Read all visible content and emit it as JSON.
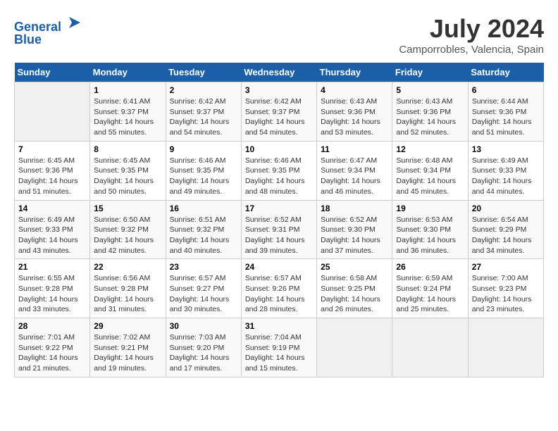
{
  "header": {
    "logo_line1": "General",
    "logo_line2": "Blue",
    "month_year": "July 2024",
    "location": "Camporrobles, Valencia, Spain"
  },
  "weekdays": [
    "Sunday",
    "Monday",
    "Tuesday",
    "Wednesday",
    "Thursday",
    "Friday",
    "Saturday"
  ],
  "weeks": [
    [
      {
        "day": "",
        "text": ""
      },
      {
        "day": "1",
        "text": "Sunrise: 6:41 AM\nSunset: 9:37 PM\nDaylight: 14 hours\nand 55 minutes."
      },
      {
        "day": "2",
        "text": "Sunrise: 6:42 AM\nSunset: 9:37 PM\nDaylight: 14 hours\nand 54 minutes."
      },
      {
        "day": "3",
        "text": "Sunrise: 6:42 AM\nSunset: 9:37 PM\nDaylight: 14 hours\nand 54 minutes."
      },
      {
        "day": "4",
        "text": "Sunrise: 6:43 AM\nSunset: 9:36 PM\nDaylight: 14 hours\nand 53 minutes."
      },
      {
        "day": "5",
        "text": "Sunrise: 6:43 AM\nSunset: 9:36 PM\nDaylight: 14 hours\nand 52 minutes."
      },
      {
        "day": "6",
        "text": "Sunrise: 6:44 AM\nSunset: 9:36 PM\nDaylight: 14 hours\nand 51 minutes."
      }
    ],
    [
      {
        "day": "7",
        "text": "Sunrise: 6:45 AM\nSunset: 9:36 PM\nDaylight: 14 hours\nand 51 minutes."
      },
      {
        "day": "8",
        "text": "Sunrise: 6:45 AM\nSunset: 9:35 PM\nDaylight: 14 hours\nand 50 minutes."
      },
      {
        "day": "9",
        "text": "Sunrise: 6:46 AM\nSunset: 9:35 PM\nDaylight: 14 hours\nand 49 minutes."
      },
      {
        "day": "10",
        "text": "Sunrise: 6:46 AM\nSunset: 9:35 PM\nDaylight: 14 hours\nand 48 minutes."
      },
      {
        "day": "11",
        "text": "Sunrise: 6:47 AM\nSunset: 9:34 PM\nDaylight: 14 hours\nand 46 minutes."
      },
      {
        "day": "12",
        "text": "Sunrise: 6:48 AM\nSunset: 9:34 PM\nDaylight: 14 hours\nand 45 minutes."
      },
      {
        "day": "13",
        "text": "Sunrise: 6:49 AM\nSunset: 9:33 PM\nDaylight: 14 hours\nand 44 minutes."
      }
    ],
    [
      {
        "day": "14",
        "text": "Sunrise: 6:49 AM\nSunset: 9:33 PM\nDaylight: 14 hours\nand 43 minutes."
      },
      {
        "day": "15",
        "text": "Sunrise: 6:50 AM\nSunset: 9:32 PM\nDaylight: 14 hours\nand 42 minutes."
      },
      {
        "day": "16",
        "text": "Sunrise: 6:51 AM\nSunset: 9:32 PM\nDaylight: 14 hours\nand 40 minutes."
      },
      {
        "day": "17",
        "text": "Sunrise: 6:52 AM\nSunset: 9:31 PM\nDaylight: 14 hours\nand 39 minutes."
      },
      {
        "day": "18",
        "text": "Sunrise: 6:52 AM\nSunset: 9:30 PM\nDaylight: 14 hours\nand 37 minutes."
      },
      {
        "day": "19",
        "text": "Sunrise: 6:53 AM\nSunset: 9:30 PM\nDaylight: 14 hours\nand 36 minutes."
      },
      {
        "day": "20",
        "text": "Sunrise: 6:54 AM\nSunset: 9:29 PM\nDaylight: 14 hours\nand 34 minutes."
      }
    ],
    [
      {
        "day": "21",
        "text": "Sunrise: 6:55 AM\nSunset: 9:28 PM\nDaylight: 14 hours\nand 33 minutes."
      },
      {
        "day": "22",
        "text": "Sunrise: 6:56 AM\nSunset: 9:28 PM\nDaylight: 14 hours\nand 31 minutes."
      },
      {
        "day": "23",
        "text": "Sunrise: 6:57 AM\nSunset: 9:27 PM\nDaylight: 14 hours\nand 30 minutes."
      },
      {
        "day": "24",
        "text": "Sunrise: 6:57 AM\nSunset: 9:26 PM\nDaylight: 14 hours\nand 28 minutes."
      },
      {
        "day": "25",
        "text": "Sunrise: 6:58 AM\nSunset: 9:25 PM\nDaylight: 14 hours\nand 26 minutes."
      },
      {
        "day": "26",
        "text": "Sunrise: 6:59 AM\nSunset: 9:24 PM\nDaylight: 14 hours\nand 25 minutes."
      },
      {
        "day": "27",
        "text": "Sunrise: 7:00 AM\nSunset: 9:23 PM\nDaylight: 14 hours\nand 23 minutes."
      }
    ],
    [
      {
        "day": "28",
        "text": "Sunrise: 7:01 AM\nSunset: 9:22 PM\nDaylight: 14 hours\nand 21 minutes."
      },
      {
        "day": "29",
        "text": "Sunrise: 7:02 AM\nSunset: 9:21 PM\nDaylight: 14 hours\nand 19 minutes."
      },
      {
        "day": "30",
        "text": "Sunrise: 7:03 AM\nSunset: 9:20 PM\nDaylight: 14 hours\nand 17 minutes."
      },
      {
        "day": "31",
        "text": "Sunrise: 7:04 AM\nSunset: 9:19 PM\nDaylight: 14 hours\nand 15 minutes."
      },
      {
        "day": "",
        "text": ""
      },
      {
        "day": "",
        "text": ""
      },
      {
        "day": "",
        "text": ""
      }
    ]
  ]
}
